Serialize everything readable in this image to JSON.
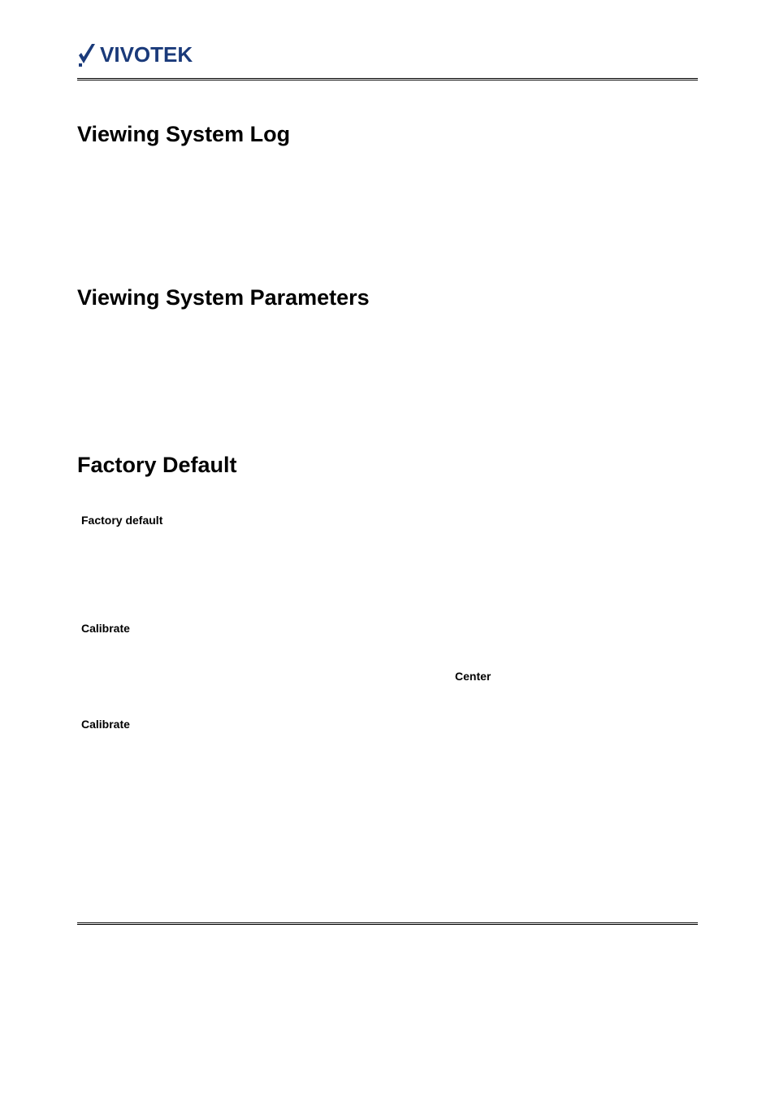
{
  "logo": {
    "brand": "VIVOTEK"
  },
  "headings": {
    "h1": "Viewing System Log",
    "h2": "Viewing System Parameters",
    "h3": "Factory Default"
  },
  "content": {
    "factory_default_label": "Factory default",
    "calibrate_label": "Calibrate",
    "center_label": "Center",
    "calibrate_label_2": "Calibrate"
  }
}
